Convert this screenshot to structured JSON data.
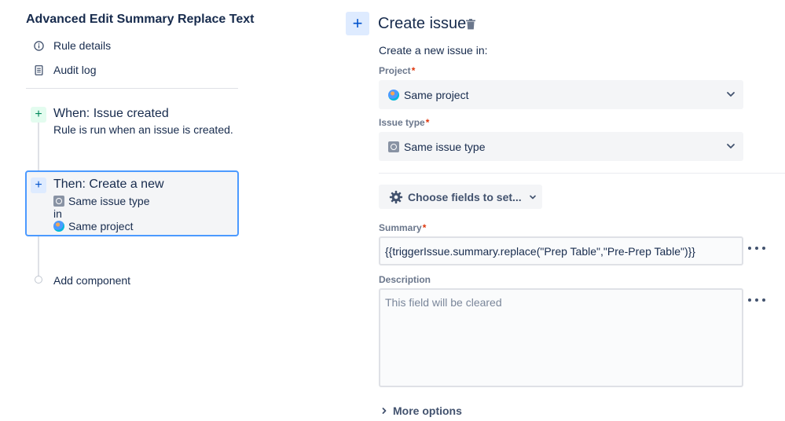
{
  "rule": {
    "title": "Advanced Edit Summary Replace Text",
    "nav": [
      {
        "label": "Rule details",
        "icon": "info-icon"
      },
      {
        "label": "Audit log",
        "icon": "document-icon"
      }
    ],
    "trigger": {
      "title": "When: Issue created",
      "description": "Rule is run when an issue is created."
    },
    "action": {
      "title": "Then: Create a new",
      "issue_type": "Same issue type",
      "connector": "in",
      "project": "Same project"
    },
    "add_component": "Add component"
  },
  "panel": {
    "title": "Create issue",
    "subtitle": "Create a new issue in:",
    "project": {
      "label": "Project",
      "required_mark": "*",
      "value": "Same project"
    },
    "issue_type": {
      "label": "Issue type",
      "required_mark": "*",
      "value": "Same issue type"
    },
    "choose_fields": "Choose fields to set...",
    "summary": {
      "label": "Summary",
      "required_mark": "*",
      "value": "{{triggerIssue.summary.replace(\"Prep Table\",\"Pre-Prep Table\")}}"
    },
    "description": {
      "label": "Description",
      "placeholder": "This field will be cleared"
    },
    "more_options": "More options"
  },
  "colors": {
    "accent": "#0052cc",
    "selected_border": "#4c9aff",
    "trigger_plus": "#00875a",
    "required": "#de350b",
    "field_bg": "#f4f5f7"
  }
}
